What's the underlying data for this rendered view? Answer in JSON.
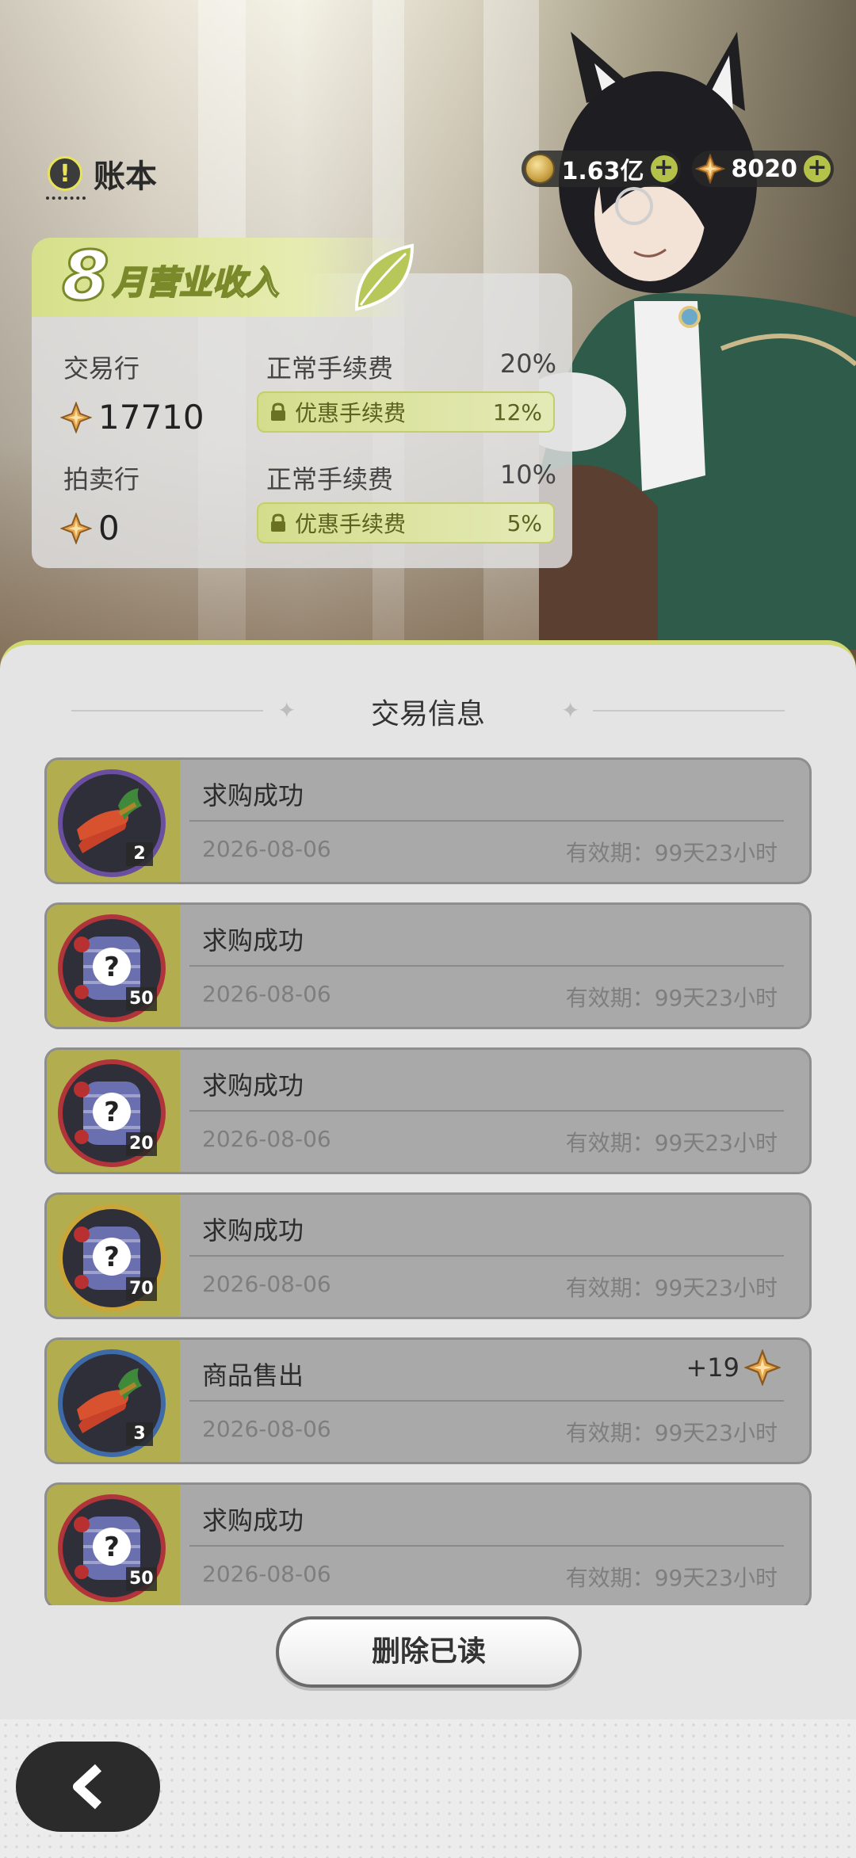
{
  "header": {
    "title": "账本",
    "title_icon": "exclamation-icon",
    "currencies": [
      {
        "icon": "gold-coin-icon",
        "value": "1.63亿"
      },
      {
        "icon": "star-gem-icon",
        "value": "8020"
      }
    ]
  },
  "revenue": {
    "month": "8",
    "label": "月营业收入",
    "markets": [
      {
        "name": "交易行",
        "amount": "17710",
        "normal_fee_label": "正常手续费",
        "normal_fee": "20%",
        "discount_fee_label": "优惠手续费",
        "discount_fee": "12%"
      },
      {
        "name": "拍卖行",
        "amount": "0",
        "normal_fee_label": "正常手续费",
        "normal_fee": "10%",
        "discount_fee_label": "优惠手续费",
        "discount_fee": "5%"
      }
    ]
  },
  "panel": {
    "title": "交易信息",
    "items": [
      {
        "title": "求购成功",
        "date": "2026-08-06",
        "expiry": "有效期：99天23小时",
        "count": "2",
        "icon": "chili-pepper-icon",
        "ring": "#6a4fa0",
        "reward": null
      },
      {
        "title": "求购成功",
        "date": "2026-08-06",
        "expiry": "有效期：99天23小时",
        "count": "50",
        "icon": "mystery-item-icon",
        "ring": "#b0343a",
        "reward": null
      },
      {
        "title": "求购成功",
        "date": "2026-08-06",
        "expiry": "有效期：99天23小时",
        "count": "20",
        "icon": "mystery-item-icon",
        "ring": "#b0343a",
        "reward": null
      },
      {
        "title": "求购成功",
        "date": "2026-08-06",
        "expiry": "有效期：99天23小时",
        "count": "70",
        "icon": "mystery-item-icon",
        "ring": "#c9a63a",
        "reward": null
      },
      {
        "title": "商品售出",
        "date": "2026-08-06",
        "expiry": "有效期：99天23小时",
        "count": "3",
        "icon": "chili-pepper-icon",
        "ring": "#3f6aa8",
        "reward": "+19"
      },
      {
        "title": "求购成功",
        "date": "2026-08-06",
        "expiry": "有效期：99天23小时",
        "count": "50",
        "icon": "mystery-item-icon",
        "ring": "#b0343a",
        "reward": null
      }
    ],
    "delete_button": "删除已读"
  },
  "footer": {
    "back_icon": "chevron-left-icon"
  }
}
